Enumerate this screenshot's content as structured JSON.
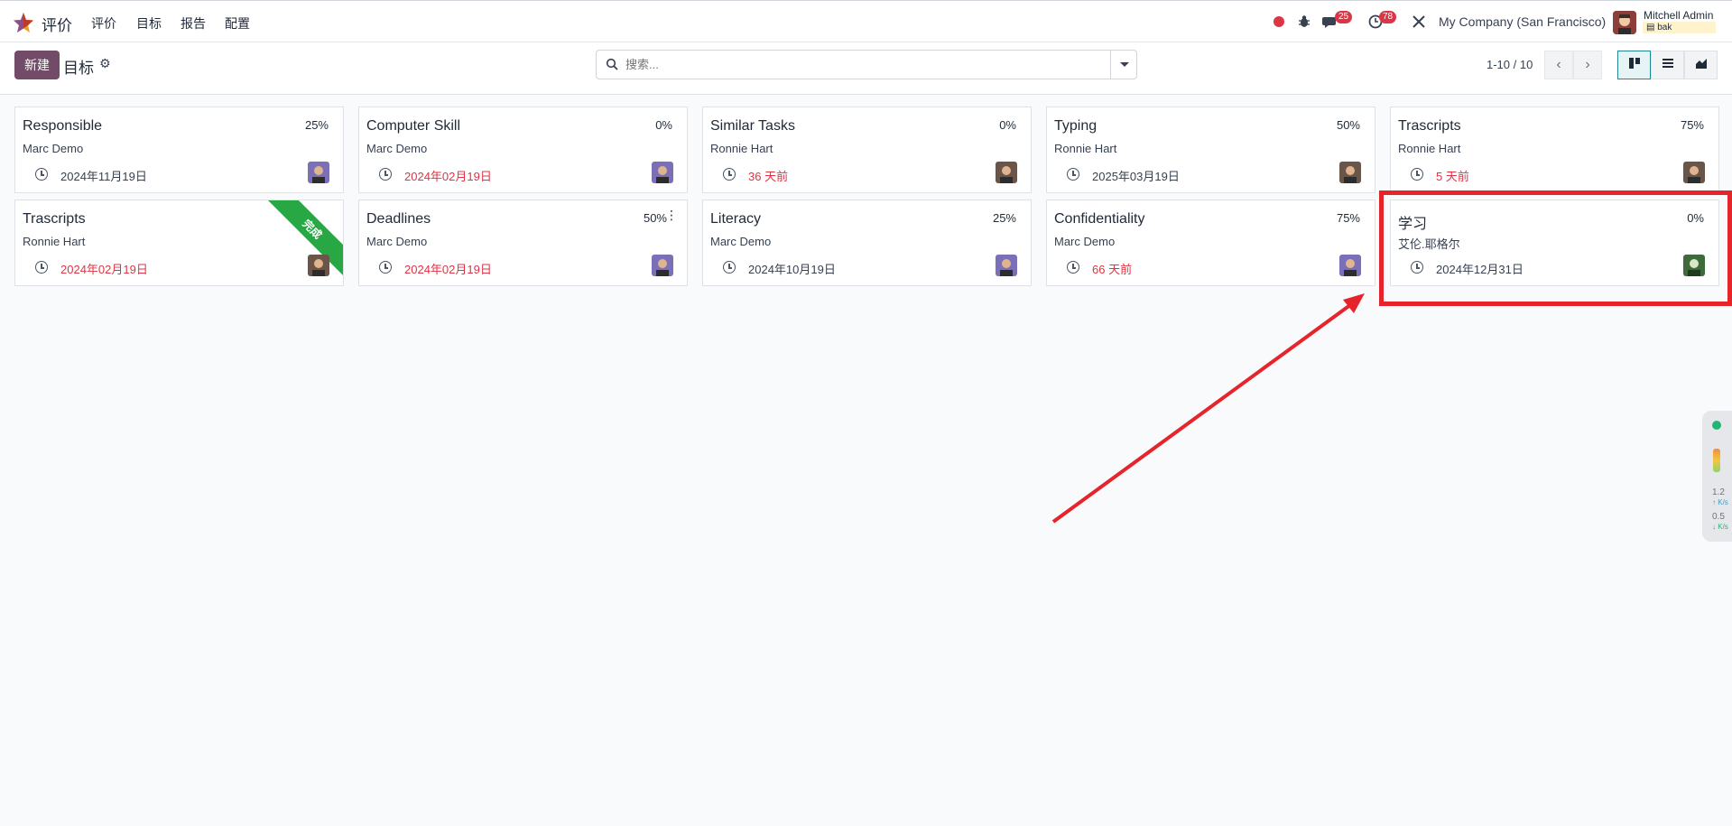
{
  "navbar": {
    "app_name": "评价",
    "menu": [
      "评价",
      "目标",
      "报告",
      "配置"
    ],
    "chat_badge": "25",
    "activity_badge": "78",
    "company": "My Company (San Francisco)",
    "user_name": "Mitchell Admin",
    "user_db": "bak"
  },
  "control": {
    "new_label": "新建",
    "title": "目标",
    "search_placeholder": "搜索...",
    "pager": "1-10 / 10"
  },
  "cards": [
    {
      "title": "Responsible",
      "pct": "25%",
      "person": "Marc Demo",
      "date": "2024年11月19日",
      "late": false,
      "avatar": "purple"
    },
    {
      "title": "Computer Skill",
      "pct": "0%",
      "person": "Marc Demo",
      "date": "2024年02月19日",
      "late": true,
      "avatar": "purple"
    },
    {
      "title": "Similar Tasks",
      "pct": "0%",
      "person": "Ronnie Hart",
      "date": "36 天前",
      "late": true,
      "avatar": "dark"
    },
    {
      "title": "Typing",
      "pct": "50%",
      "person": "Ronnie Hart",
      "date": "2025年03月19日",
      "late": false,
      "avatar": "dark"
    },
    {
      "title": "Trascripts",
      "pct": "75%",
      "person": "Ronnie Hart",
      "date": "5 天前",
      "late": true,
      "avatar": "dark"
    },
    {
      "title": "Trascripts",
      "pct": "",
      "person": "Ronnie Hart",
      "date": "2024年02月19日",
      "late": true,
      "avatar": "dark",
      "ribbon": "完成"
    },
    {
      "title": "Deadlines",
      "pct": "50%",
      "person": "Marc Demo",
      "date": "2024年02月19日",
      "late": true,
      "avatar": "purple"
    },
    {
      "title": "Literacy",
      "pct": "25%",
      "person": "Marc Demo",
      "date": "2024年10月19日",
      "late": false,
      "avatar": "purple"
    },
    {
      "title": "Confidentiality",
      "pct": "75%",
      "person": "Marc Demo",
      "date": "66 天前",
      "late": true,
      "avatar": "purple"
    },
    {
      "title": "学习",
      "pct": "0%",
      "person": "艾伦.耶格尔",
      "date": "2024年12月31日",
      "late": false,
      "avatar": "green"
    }
  ],
  "side_widget": {
    "up": "1.2",
    "up_unit": "K/s",
    "down": "0.5",
    "down_unit": "K/s"
  },
  "colors": {
    "brand": "#714b67",
    "late": "#dc3545",
    "annotation": "#e5242b",
    "ribbon": "#28a745"
  }
}
